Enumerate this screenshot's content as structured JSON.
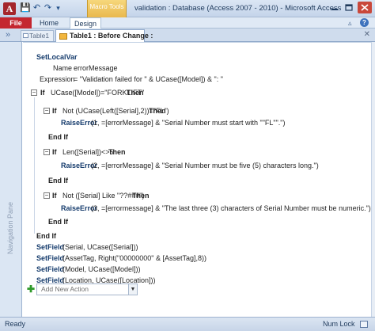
{
  "window": {
    "app_icon": "A",
    "contextual_tab": "Macro Tools",
    "title": "validation : Database (Access 2007 - 2010)  -  Microsoft Access",
    "minimize_icon": "minimize-icon",
    "maximize_icon": "maximize-icon",
    "close_icon": "close-icon"
  },
  "quick_access": {
    "save_icon": "💾",
    "undo_icon": "↶",
    "redo_icon": "↷",
    "customize_icon": "▾"
  },
  "ribbon": {
    "file": "File",
    "home": "Home",
    "design": "Design",
    "minimize_ribbon": "▵",
    "help": "?"
  },
  "doc_tabs": {
    "nav_toggle": "»",
    "table1": "Table1",
    "active": "Table1 : Before Change :",
    "close": "✕"
  },
  "nav_pane": {
    "label": "Navigation Pane"
  },
  "macro": {
    "setlocalvar": {
      "action": "SetLocalVar",
      "name_label": "Name",
      "name_value": "errorMessage",
      "expr_label": "Expression",
      "expr_value": "= \"Validation failed for \" & UCase([Model]) & \": \""
    },
    "if_outer": {
      "kw_if": "If",
      "condition": "UCase([Model])=\"FORKLIFT\"",
      "kw_then": "Then",
      "toggle": "−"
    },
    "if1": {
      "kw_if": "If",
      "condition": "Not (UCase(Left([Serial],2))=\"FL\")",
      "kw_then": "Then",
      "toggle": "−",
      "action": "RaiseError",
      "args": "(1, =[errorMessage] & \"Serial Number must start with \"\"FL\"\".\")",
      "end": "End If"
    },
    "if2": {
      "kw_if": "If",
      "condition": "Len([Serial])<>5",
      "kw_then": "Then",
      "toggle": "−",
      "action": "RaiseError",
      "args": "(2, =[errorMessage] & \"Serial Number must be five (5) characters long.\")",
      "end": "End If"
    },
    "if3": {
      "kw_if": "If",
      "condition": "Not ([Serial] Like \"??###\")",
      "kw_then": "Then",
      "toggle": "−",
      "action": "RaiseError",
      "args": "(3, =[errormessage] & \"The last three (3) characters of Serial Number must be numeric.\")",
      "end": "End If"
    },
    "outer_end": "End If",
    "setfields": [
      {
        "action": "SetField",
        "args": "(Serial, UCase([Serial]))"
      },
      {
        "action": "SetField",
        "args": "(AssetTag, Right(\"00000000\" & [AssetTag],8))"
      },
      {
        "action": "SetField",
        "args": "(Model, UCase([Model]))"
      },
      {
        "action": "SetField",
        "args": "(Location, UCase([Location]))"
      }
    ],
    "add_action": {
      "plus": "✚",
      "placeholder": "Add New Action",
      "dropdown": "▼"
    }
  },
  "status": {
    "ready": "Ready",
    "numlock": "Num Lock"
  }
}
